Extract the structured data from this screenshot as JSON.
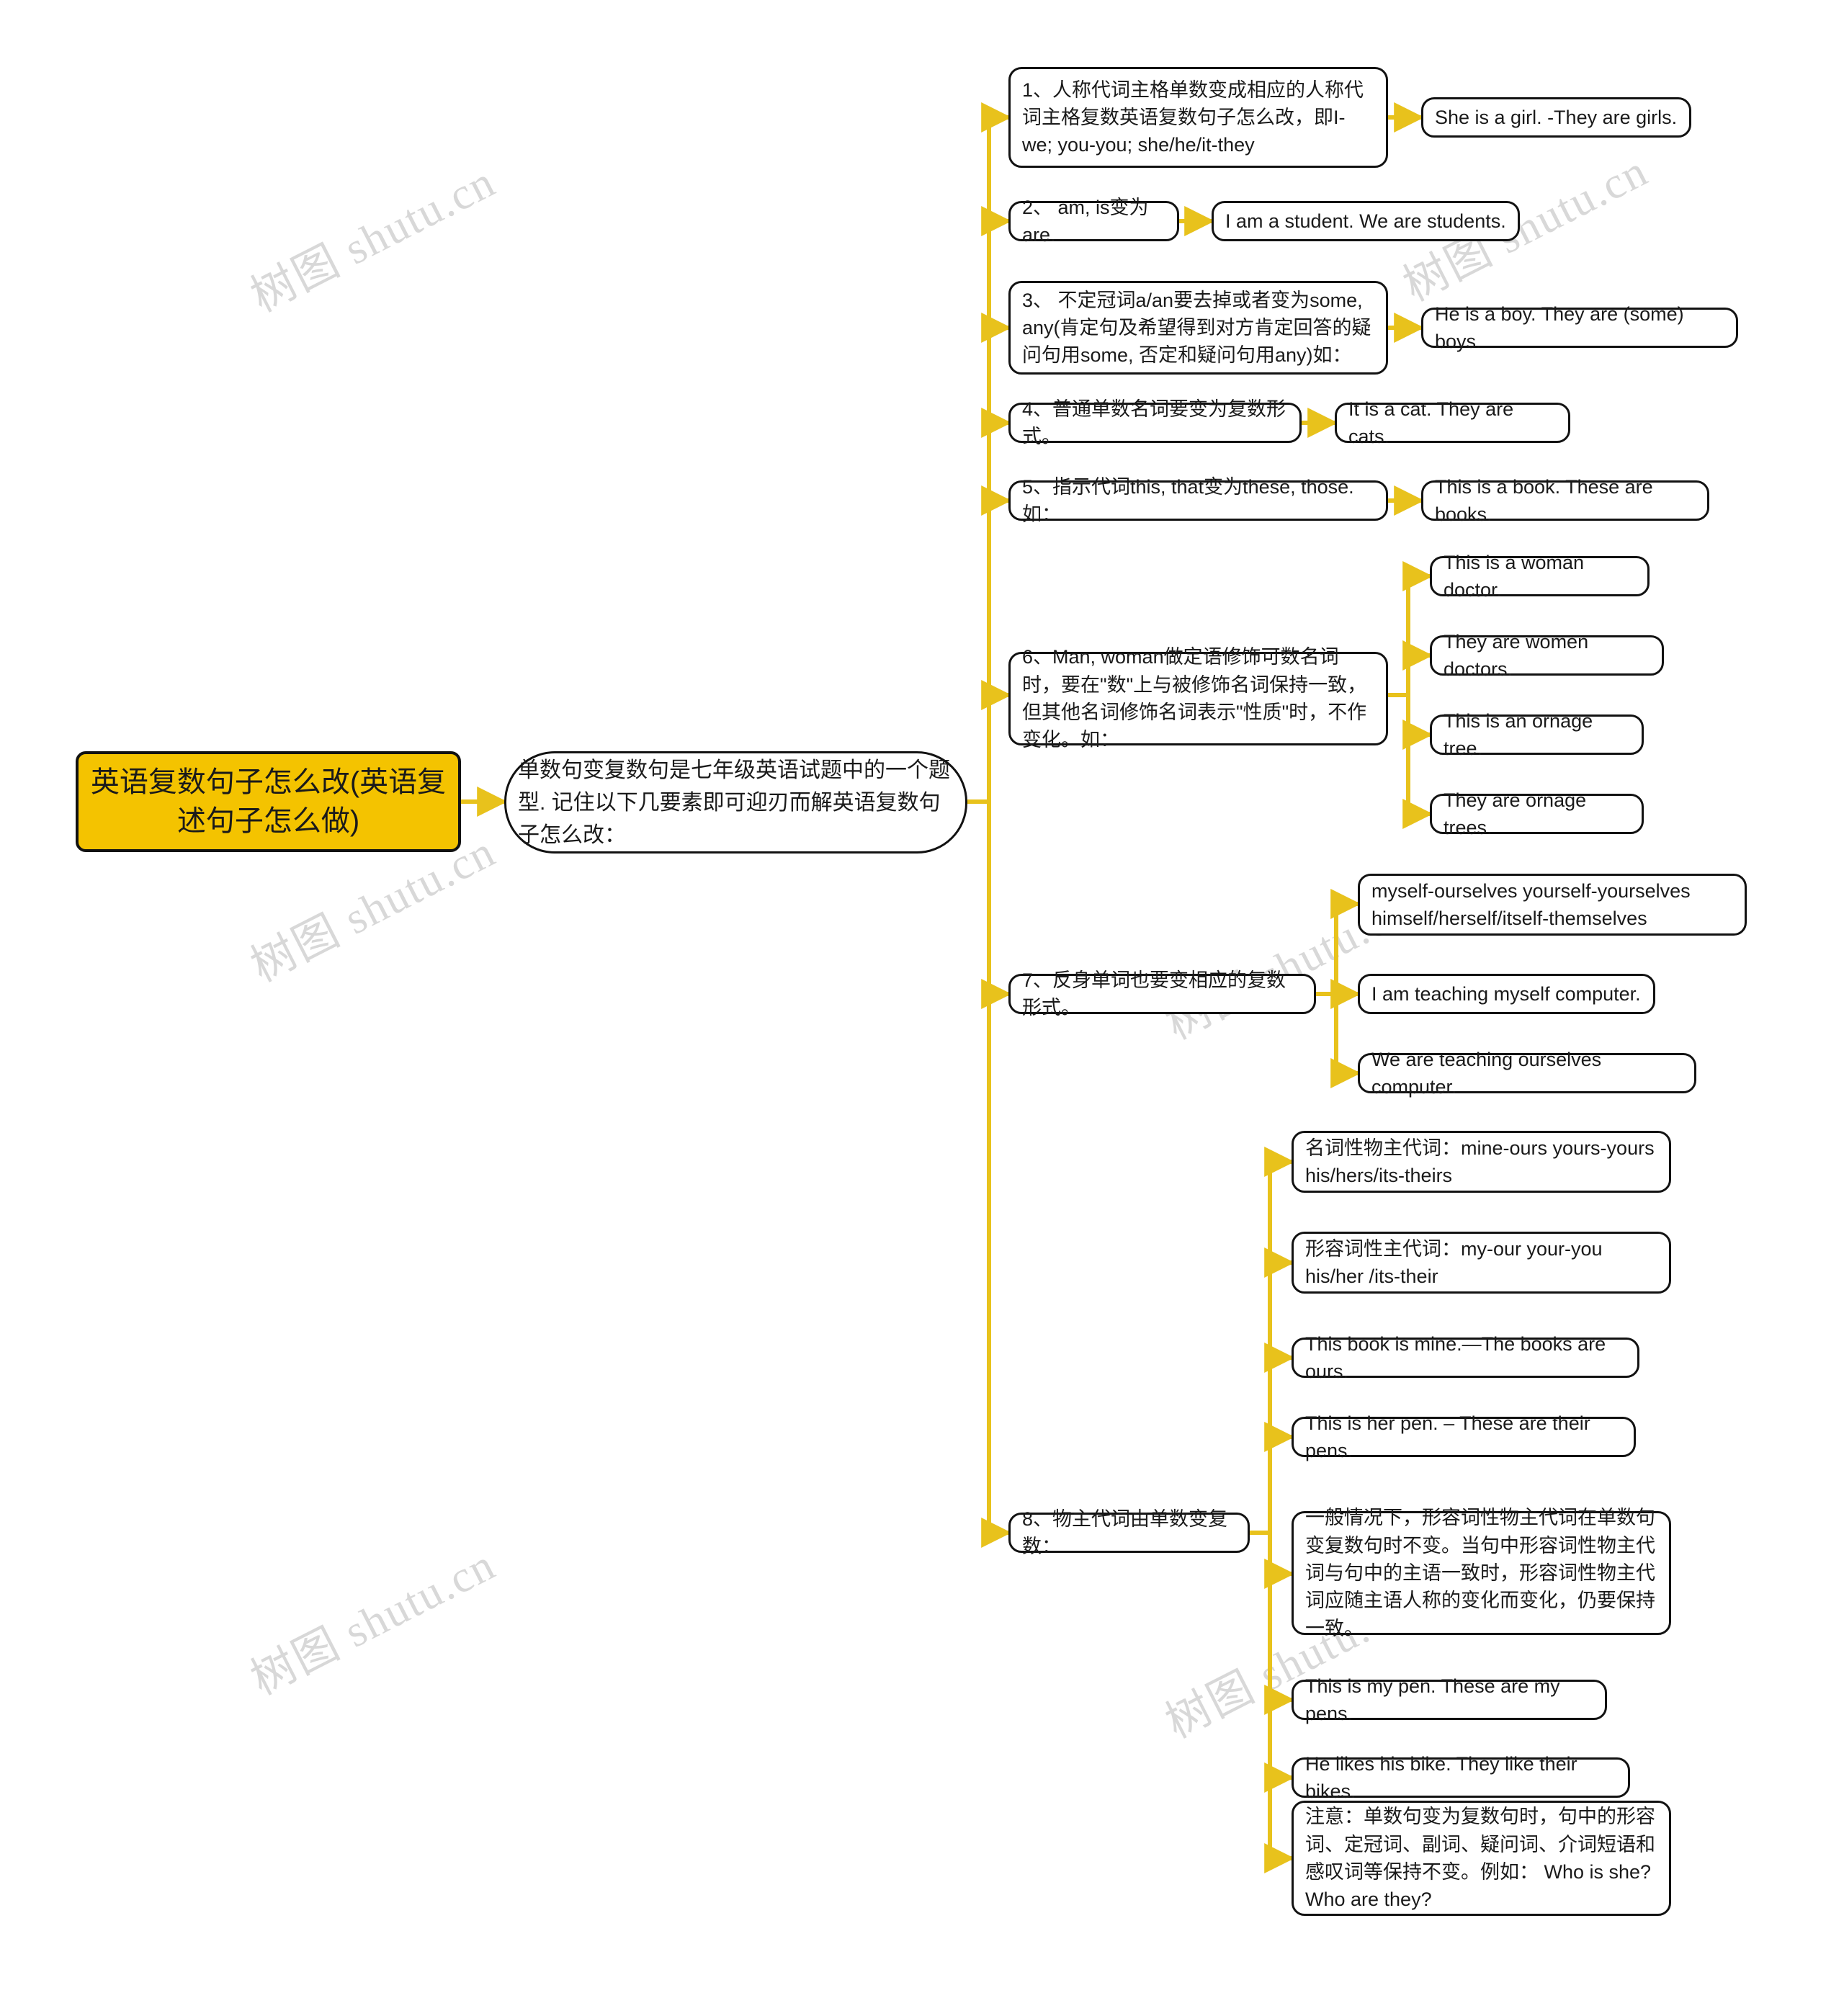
{
  "meta": {
    "watermark_text": "树图 shutu.cn",
    "root_fill": "#F4C300",
    "link_color": "#E8C21C",
    "node_border": "#121212"
  },
  "root": {
    "label": "英语复数句子怎么改(英语复述句子怎么做)"
  },
  "intro": {
    "label": "单数句变复数句是七年级英语试题中的一个题型. 记住以下几要素即可迎刃而解英语复数句子怎么改："
  },
  "branches": [
    {
      "id": "b1",
      "label": "1、人称代词主格单数变成相应的人称代词主格复数英语复数句子怎么改，即I-we; you-you; she/he/it-they",
      "children": [
        {
          "id": "b1c1",
          "label": "She is a girl. -They are girls."
        }
      ]
    },
    {
      "id": "b2",
      "label": "2、 am, is变为are.",
      "children": [
        {
          "id": "b2c1",
          "label": "I am a student. We are students."
        }
      ]
    },
    {
      "id": "b3",
      "label": "3、 不定冠词a/an要去掉或者变为some, any(肯定句及希望得到对方肯定回答的疑问句用some, 否定和疑问句用any)如：",
      "children": [
        {
          "id": "b3c1",
          "label": "He is a boy. They are (some) boys."
        }
      ]
    },
    {
      "id": "b4",
      "label": "4、普通单数名词要变为复数形式。",
      "children": [
        {
          "id": "b4c1",
          "label": "It is a cat. They are cats."
        }
      ]
    },
    {
      "id": "b5",
      "label": "5、指示代词this, that变为these, those.如：",
      "children": [
        {
          "id": "b5c1",
          "label": "This is a book. These are books."
        }
      ]
    },
    {
      "id": "b6",
      "label": "6、Man, woman做定语修饰可数名词时，要在\"数\"上与被修饰名词保持一致，但其他名词修饰名词表示\"性质\"时，不作变化。如：",
      "children": [
        {
          "id": "b6c1",
          "label": "This is a woman doctor."
        },
        {
          "id": "b6c2",
          "label": "They are women doctors."
        },
        {
          "id": "b6c3",
          "label": "This is an ornage tree."
        },
        {
          "id": "b6c4",
          "label": "They are ornage trees."
        }
      ]
    },
    {
      "id": "b7",
      "label": "7、反身单词也要变相应的复数形式。",
      "children": [
        {
          "id": "b7c1",
          "label": "myself-ourselves yourself-yourselves himself/herself/itself-themselves"
        },
        {
          "id": "b7c2",
          "label": "I am teaching myself computer."
        },
        {
          "id": "b7c3",
          "label": "We are teaching ourselves computer."
        }
      ]
    },
    {
      "id": "b8",
      "label": "8、物主代词由单数变复数：",
      "children": [
        {
          "id": "b8c1",
          "label": "名词性物主代词：mine-ours yours-yours his/hers/its-theirs"
        },
        {
          "id": "b8c2",
          "label": "形容词性主代词：my-our your-you his/her /its-their"
        },
        {
          "id": "b8c3",
          "label": "This book is mine.—The books are ours."
        },
        {
          "id": "b8c4",
          "label": "This is her pen. – These are their pens."
        },
        {
          "id": "b8c5",
          "label": "一般情况下，形容词性物主代词在单数句变复数句时不变。当句中形容词性物主代词与句中的主语一致时，形容词性物主代词应随主语人称的变化而变化，仍要保持一致。"
        },
        {
          "id": "b8c6",
          "label": "This is my pen. These are my pens."
        },
        {
          "id": "b8c7",
          "label": "He likes his bike. They like their bikes."
        },
        {
          "id": "b8c8",
          "label": "注意：单数句变为复数句时，句中的形容词、定冠词、副词、疑问词、介词短语和感叹词等保持不变。例如： Who is she? Who are they?"
        }
      ]
    }
  ]
}
